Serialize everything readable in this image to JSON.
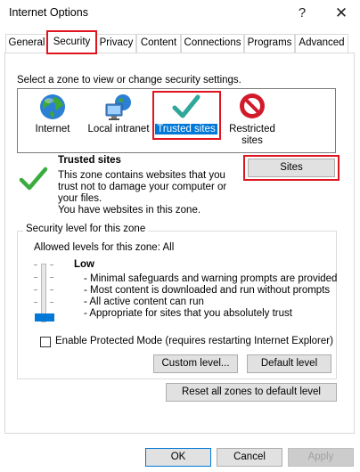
{
  "window": {
    "title": "Internet Options",
    "help_glyph": "?",
    "close_glyph": "✕"
  },
  "tabs": [
    {
      "label": "General"
    },
    {
      "label": "Security",
      "active": true
    },
    {
      "label": "Privacy"
    },
    {
      "label": "Content"
    },
    {
      "label": "Connections"
    },
    {
      "label": "Programs"
    },
    {
      "label": "Advanced"
    }
  ],
  "security": {
    "zone_prompt": "Select a zone to view or change security settings.",
    "zones": [
      {
        "label": "Internet",
        "icon": "globe-icon"
      },
      {
        "label": "Local intranet",
        "icon": "network-computer-icon"
      },
      {
        "label": "Trusted sites",
        "icon": "checkmark-icon",
        "selected": true
      },
      {
        "label_line1": "Restricted",
        "label_line2": "sites",
        "icon": "prohibited-icon"
      }
    ],
    "zone_detail": {
      "name": "Trusted sites",
      "description_lines": [
        "This zone contains websites that you",
        "trust not to damage your computer or",
        "your files.",
        "You have websites in this zone."
      ],
      "sites_button": "Sites"
    },
    "level_group": {
      "title": "Security level for this zone",
      "allowed_text": "Allowed levels for this zone: All",
      "level_name": "Low",
      "slider_position": "lowest",
      "bullets": [
        "- Minimal safeguards and warning prompts are provided",
        "- Most content is downloaded and run without prompts",
        "- All active content can run",
        "- Appropriate for sites that you absolutely trust"
      ],
      "protected_mode_label": "Enable Protected Mode (requires restarting Internet Explorer)",
      "protected_mode_checked": false,
      "custom_level_button": "Custom level...",
      "default_level_button": "Default level"
    },
    "reset_all_button": "Reset all zones to default level"
  },
  "footer": {
    "ok": "OK",
    "cancel": "Cancel",
    "apply": "Apply"
  },
  "colors": {
    "accent": "#0078d7",
    "highlight_outline": "#e0141e",
    "check_green": "#2fa53a"
  }
}
